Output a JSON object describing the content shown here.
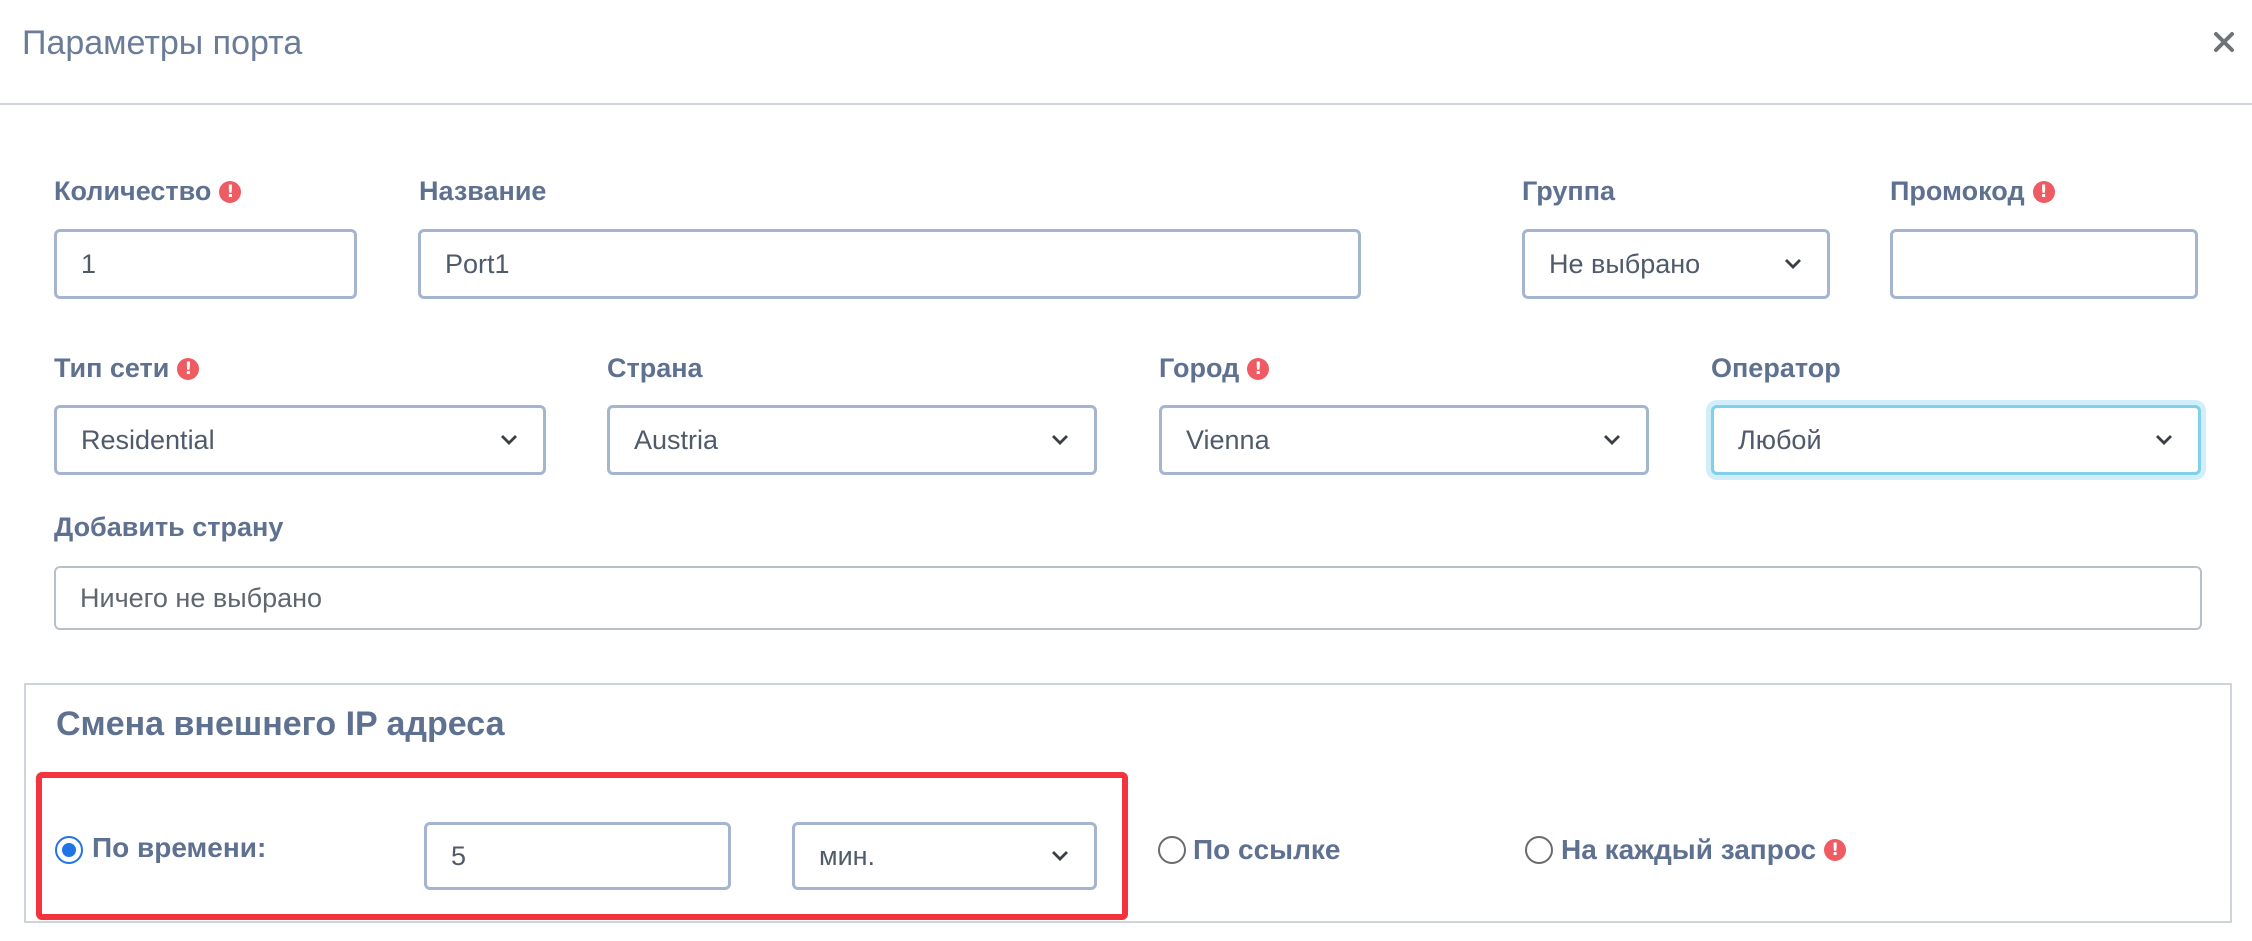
{
  "dialog": {
    "title": "Параметры порта"
  },
  "fields": {
    "quantity": {
      "label": "Количество",
      "value": "1"
    },
    "name": {
      "label": "Название",
      "value": "Port1"
    },
    "group": {
      "label": "Группа",
      "value": "Не выбрано"
    },
    "promo": {
      "label": "Промокод",
      "value": ""
    },
    "network_type": {
      "label": "Тип сети",
      "value": "Residential"
    },
    "country": {
      "label": "Страна",
      "value": "Austria"
    },
    "city": {
      "label": "Город",
      "value": "Vienna"
    },
    "operator": {
      "label": "Оператор",
      "value": "Любой"
    },
    "add_country": {
      "label": "Добавить страну",
      "value": "Ничего не выбрано"
    }
  },
  "ip_change": {
    "title": "Смена внешнего IP адреса",
    "by_time": {
      "label": "По времени:",
      "selected": true,
      "amount": "5",
      "unit": "мин."
    },
    "by_link": {
      "label": "По ссылке",
      "selected": false
    },
    "per_request": {
      "label": "На каждый запрос",
      "selected": false
    }
  },
  "icons": {
    "warning": "exclamation-circle-icon",
    "close": "close-icon",
    "dropdown": "chevron-down-icon"
  },
  "colors": {
    "label": "#5f7190",
    "input_border": "#a5b4cf",
    "warning": "#ee5b63",
    "focus": "#7fd0ea",
    "radio_selected": "#1f74e6",
    "highlight": "#f3333e"
  }
}
